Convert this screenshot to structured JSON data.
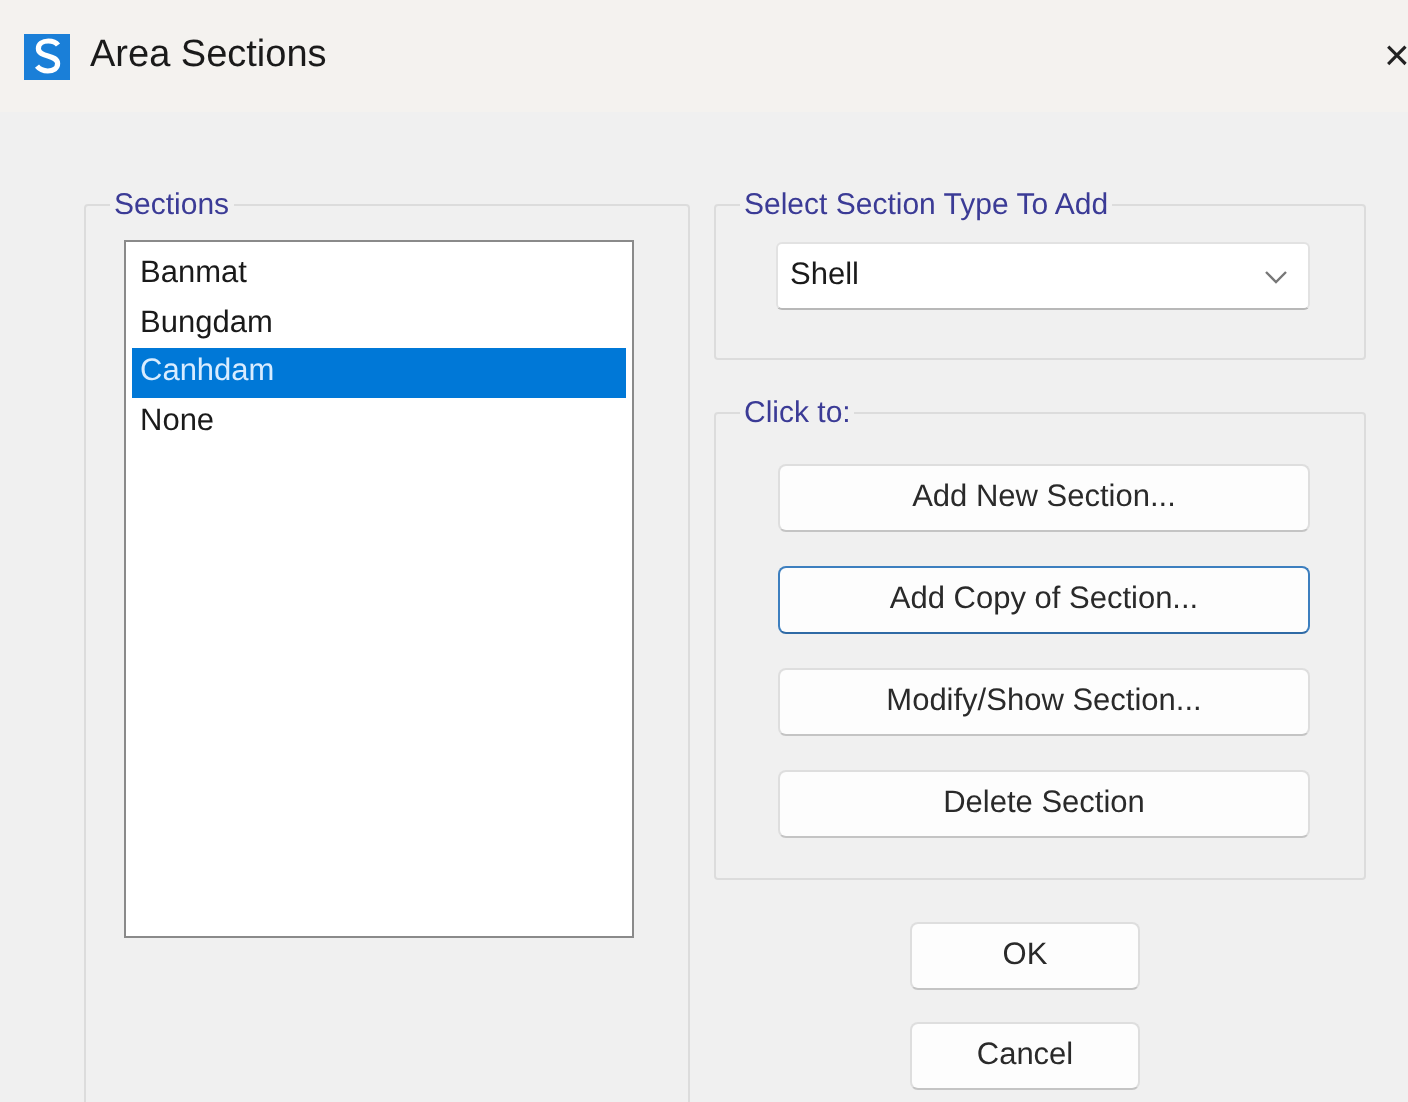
{
  "window": {
    "title": "Area Sections",
    "close": "×"
  },
  "sections": {
    "label": "Sections",
    "items": [
      {
        "label": "Banmat",
        "selected": false
      },
      {
        "label": "Bungdam",
        "selected": false
      },
      {
        "label": "Canhdam",
        "selected": true
      },
      {
        "label": "None",
        "selected": false
      }
    ]
  },
  "section_type": {
    "label": "Select Section Type To Add",
    "value": "Shell"
  },
  "actions": {
    "label": "Click to:",
    "buttons": [
      {
        "label": "Add New Section...",
        "focused": false
      },
      {
        "label": "Add Copy of Section...",
        "focused": true
      },
      {
        "label": "Modify/Show Section...",
        "focused": false
      },
      {
        "label": "Delete Section",
        "focused": false
      }
    ]
  },
  "dialog_buttons": [
    {
      "label": "OK"
    },
    {
      "label": "Cancel"
    }
  ]
}
